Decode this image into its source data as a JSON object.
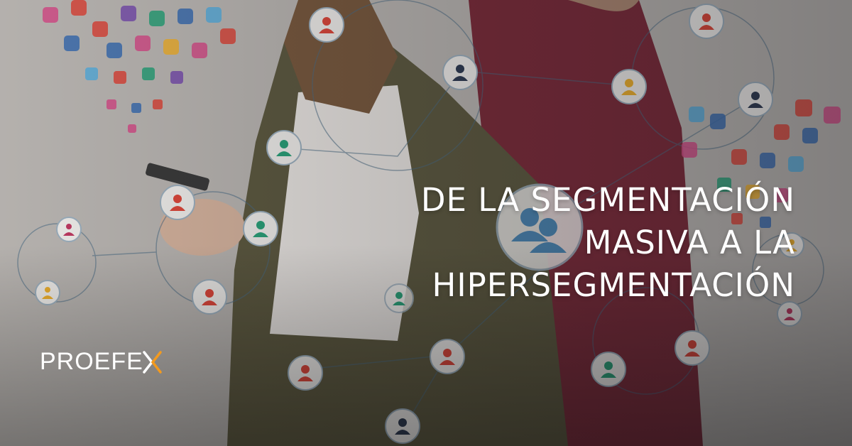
{
  "banner": {
    "headline": {
      "line1": "DE LA SEGMENTACIÓN",
      "line2": "MASIVA A LA",
      "line3": "HIPERSEGMENTACIÓN"
    },
    "brand": {
      "text": "PROEFE",
      "mark_letter": "X",
      "mark_color": "#f39a1e"
    },
    "colors": {
      "text": "#ffffff",
      "user_icons": [
        "#e0473a",
        "#2e3b52",
        "#2aa37a",
        "#f2b32e",
        "#c23a63"
      ]
    },
    "icons": [
      "user-icon",
      "social-media-icons-cluster"
    ]
  }
}
